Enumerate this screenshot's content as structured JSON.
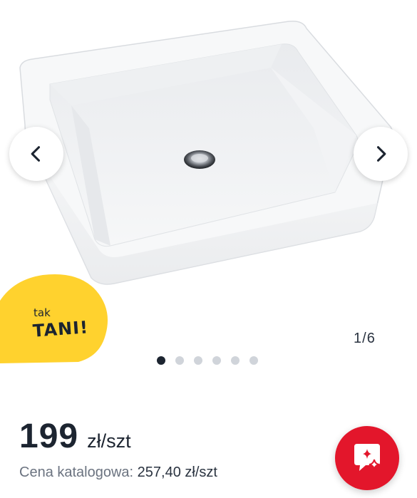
{
  "gallery": {
    "image_subject": "white rectangular ceramic countertop washbasin",
    "prev_icon": "chevron-left-icon",
    "next_icon": "chevron-right-icon",
    "counter": {
      "current": "1",
      "separator": "/",
      "total": "6"
    },
    "dots": {
      "count": 6,
      "active_index": 0
    },
    "promo": {
      "small": "tak",
      "big": "TANI!",
      "color": "#ffd22e"
    }
  },
  "price": {
    "value": "199",
    "unit": "zł/szt",
    "catalog_label": "Cena katalogowa:",
    "catalog_value": "257,40 zł/szt"
  },
  "chat": {
    "icon": "chat-sparkle-icon",
    "color": "#e3162b"
  }
}
